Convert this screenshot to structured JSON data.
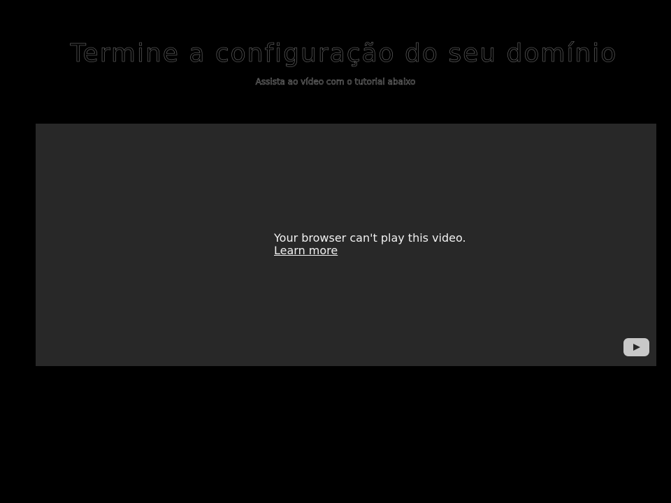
{
  "header": {
    "title": "Termine a configuração do seu domínio",
    "subtitle": "Assista ao vídeo com o tutorial abaixo"
  },
  "video": {
    "error_message": "Your browser can't play this video.",
    "learn_more_label": "Learn more",
    "logo_icon": "youtube-icon"
  }
}
